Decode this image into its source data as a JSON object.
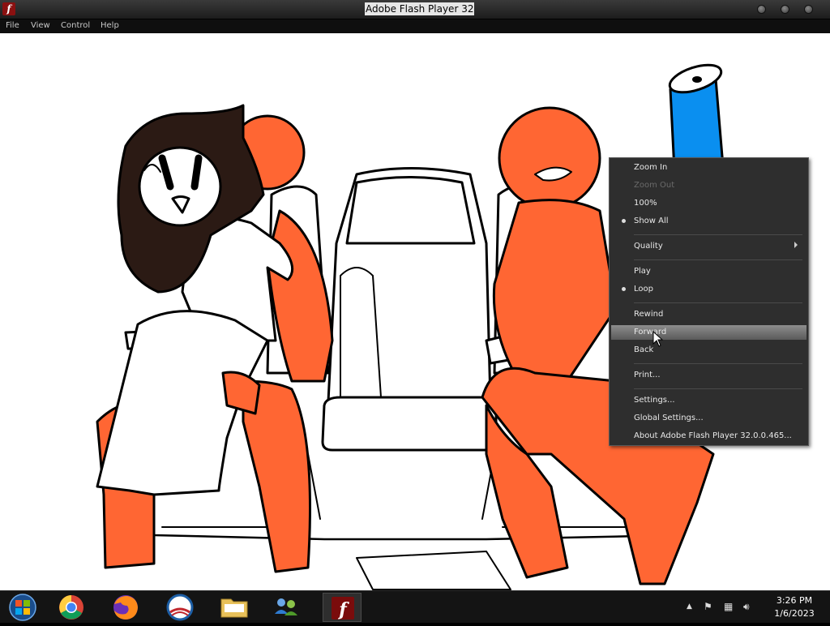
{
  "window": {
    "title": "Adobe Flash Player 32"
  },
  "menubar": {
    "items": [
      "File",
      "View",
      "Control",
      "Help"
    ]
  },
  "context_menu": {
    "items": [
      {
        "label": "Zoom In"
      },
      {
        "label": "Zoom Out",
        "disabled": true
      },
      {
        "label": "100%"
      },
      {
        "label": "Show All",
        "checked": true
      },
      {
        "label": "Quality",
        "submenu": true
      },
      {
        "label": "Play"
      },
      {
        "label": "Loop",
        "checked": true
      },
      {
        "label": "Rewind"
      },
      {
        "label": "Forward",
        "highlighted": true
      },
      {
        "label": "Back"
      },
      {
        "label": "Print..."
      },
      {
        "label": "Settings..."
      },
      {
        "label": "Global Settings..."
      },
      {
        "label": "About Adobe Flash Player 32.0.0.465..."
      }
    ]
  },
  "taskbar": {
    "apps": [
      {
        "icon": "windows-start-orb-icon"
      },
      {
        "icon": "chrome-icon"
      },
      {
        "icon": "firefox-icon"
      },
      {
        "icon": "obama-logo-icon"
      },
      {
        "icon": "file-explorer-icon"
      },
      {
        "icon": "network-people-icon"
      },
      {
        "icon": "flash-player-icon",
        "active": true
      }
    ],
    "tray_icons": [
      "show-hidden-icons-chevron-icon",
      "action-center-flag-icon",
      "network-icon",
      "volume-icon"
    ],
    "clock": {
      "time": "3:26 PM",
      "date": "1/6/2023"
    }
  },
  "colors": {
    "orange": "#ff6633",
    "blue": "#0a8ff0",
    "hair": "#2b1a14",
    "menu_bg": "#2e2e2e",
    "highlight": "#7a7a7a"
  }
}
